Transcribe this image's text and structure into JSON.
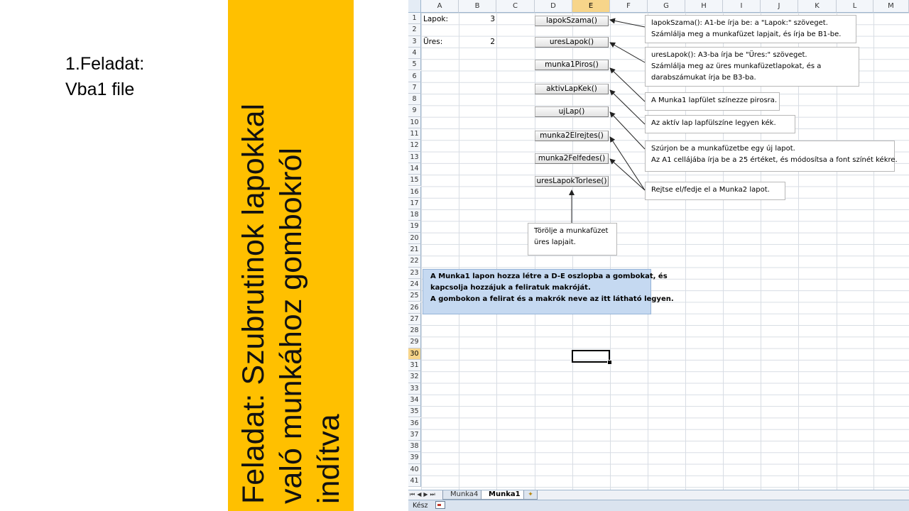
{
  "slide": {
    "task_line1": "1.Feladat:",
    "task_line2": "Vba1 file",
    "banner_lines": [
      "Feladat: Szubrutinok lapokkal",
      "való munkához gombokról",
      "indítva"
    ],
    "banner_color": "#FFC000"
  },
  "spreadsheet": {
    "columns": [
      "A",
      "B",
      "C",
      "D",
      "E",
      "F",
      "G",
      "H",
      "I",
      "J",
      "K",
      "L",
      "M"
    ],
    "rows": [
      "1",
      "2",
      "3",
      "4",
      "5",
      "6",
      "7",
      "8",
      "9",
      "10",
      "11",
      "12",
      "13",
      "14",
      "15",
      "16",
      "17",
      "18",
      "19",
      "20",
      "21",
      "22",
      "23",
      "24",
      "25",
      "26",
      "27",
      "28",
      "29",
      "30",
      "31",
      "32",
      "33",
      "34",
      "35",
      "36",
      "37",
      "38",
      "39",
      "40",
      "41"
    ],
    "active_column": "E",
    "active_row": "30",
    "cells": {
      "a1": "Lapok:",
      "b1": "3",
      "a3": "Üres:",
      "b3": "2"
    },
    "buttons": [
      "lapokSzama()",
      "uresLapok()",
      "munka1Piros()",
      "aktivLapKek()",
      "ujLap()",
      "munka2Elrejtes()",
      "munka2Felfedes()",
      "uresLapokTorlese()"
    ],
    "notes": {
      "lapokszama": [
        "lapokSzama():  A1-be írja be:  a \"Lapok:\" szöveget.",
        "Számlálja meg a munkafüzet lapjait, és írja be B1-be."
      ],
      "ureslapok": [
        "uresLapok(): A3-ba írja be \"Üres:\" szöveget.",
        "Számlálja meg az üres munkafüzetlapokat, és a",
        "darabszámukat írja be B3-ba."
      ],
      "munka1piros": [
        "A Munka1 lapfület színezze pirosra."
      ],
      "aktivlapkek": [
        "Az aktív lap lapfülszíne legyen kék."
      ],
      "ujlap": [
        "Szúrjon be a munkafüzetbe egy új lapot.",
        "Az A1 cellájába írja be a 25 értéket, és módosítsa a font színét kékre."
      ],
      "munka2": [
        "Rejtse el/fedje el a Munka2 lapot."
      ],
      "torlese": [
        "Törölje a munkafüzet",
        "üres lapjait."
      ]
    },
    "instruction": [
      "A Munka1 lapon hozza létre a D-E oszlopba a gombokat, és",
      "kapcsolja hozzájuk a feliratuk makróját.",
      "A gombokon a felirat és a makrók neve az itt látható legyen."
    ],
    "instruction_color": "#C5D9F1",
    "sheet_tabs": [
      "Munka4",
      "Munka1"
    ],
    "active_tab": "Munka1",
    "status": "Kész"
  }
}
